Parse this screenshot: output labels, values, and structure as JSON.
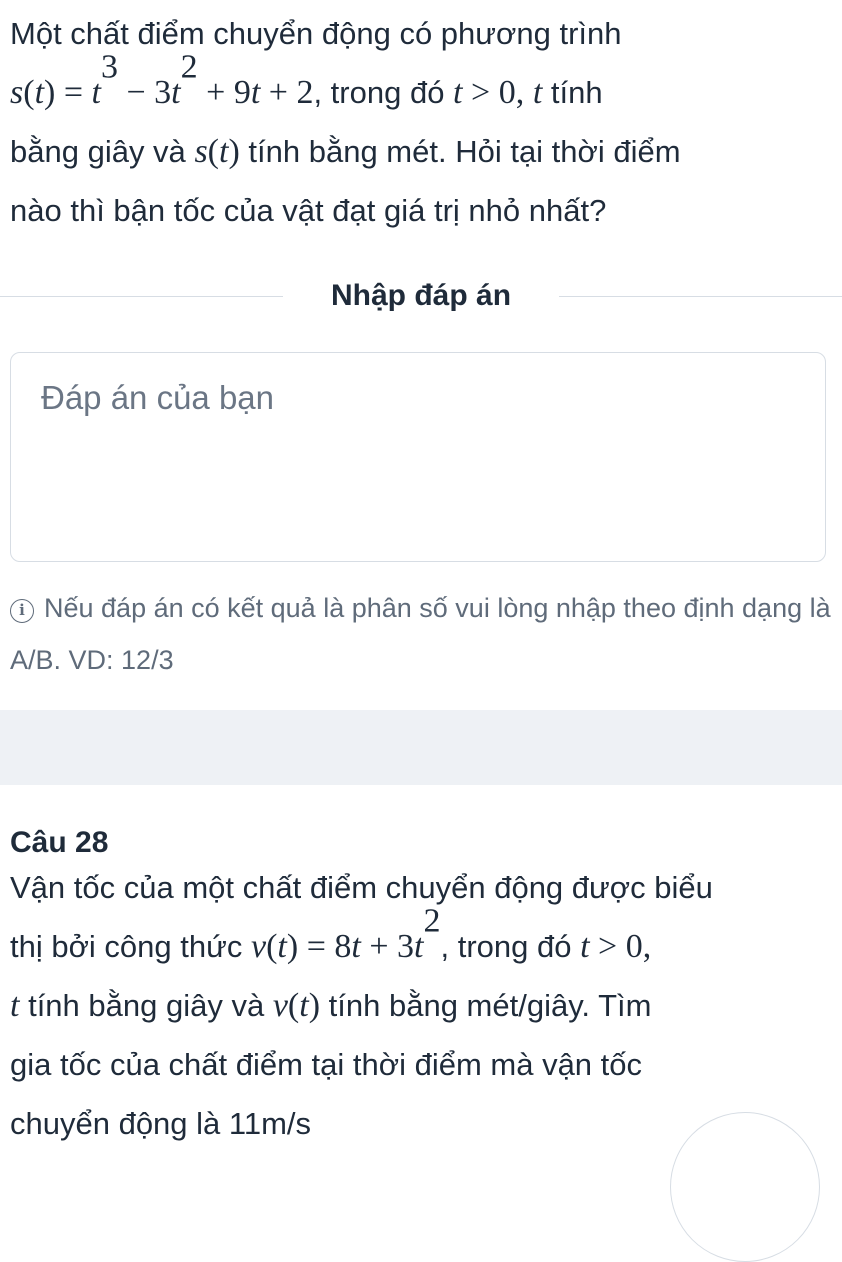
{
  "question1": {
    "line1": "Một chất điểm chuyển động có phương trình",
    "eq": "s(t) = t³ − 3t² + 9t + 2",
    "cond_prefix": ", trong đó ",
    "cond": "t > 0",
    "var_t": "t",
    "unit_t": "tính",
    "line3": "bằng giây và",
    "s_of_t": "s(t)",
    "line3_suffix": "tính bằng mét. Hỏi tại thời điểm",
    "line4": "nào thì bận tốc của vật đạt giá trị nhỏ nhất?"
  },
  "answer_section": {
    "heading": "Nhập đáp án",
    "placeholder": "Đáp án của bạn",
    "hint": "Nếu đáp án có kết quả là phân số vui lòng nhập theo định dạng là A/B. VD: 12/3"
  },
  "question2": {
    "number": "Câu 28",
    "line1": "Vận tốc của một chất điểm chuyển động được biểu",
    "line2_prefix": "thị bởi công thức",
    "eq": "v(t) = 8t + 3t²",
    "cond_prefix": ", trong đó",
    "cond": "t > 0",
    "var_t": "t",
    "line3_mid": "tính bằng giây và",
    "v_of_t": "v(t)",
    "line3_suffix": "tính bằng mét/giây. Tìm",
    "line4": "gia tốc của chất điểm tại thời điểm mà vận tốc",
    "line5": "chuyển động là 11m/s"
  },
  "icons": {
    "hint_icon": "info-icon"
  }
}
